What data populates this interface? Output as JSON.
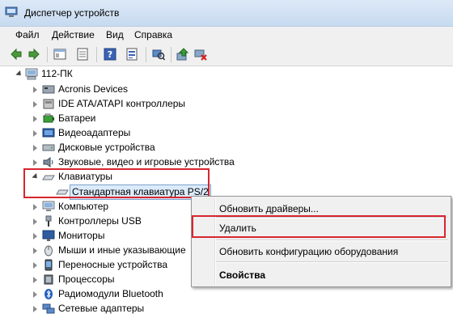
{
  "window": {
    "title": "Диспетчер устройств"
  },
  "menu": [
    "Файл",
    "Действие",
    "Вид",
    "Справка"
  ],
  "toolbar_icons": [
    "back-arrow-icon",
    "forward-arrow-icon",
    "tree-view-icon",
    "properties-sheet-icon",
    "help-icon",
    "device-list-icon",
    "scan-hardware-icon",
    "update-driver-icon",
    "uninstall-device-icon"
  ],
  "tree": {
    "root": "112-ПК",
    "items": [
      {
        "label": "Acronis Devices",
        "icon": "acronis-icon",
        "expanded": false
      },
      {
        "label": "IDE ATA/ATAPI контроллеры",
        "icon": "ide-controller-icon",
        "expanded": false
      },
      {
        "label": "Батареи",
        "icon": "battery-icon",
        "expanded": false
      },
      {
        "label": "Видеоадаптеры",
        "icon": "display-adapter-icon",
        "expanded": false
      },
      {
        "label": "Дисковые устройства",
        "icon": "disk-drive-icon",
        "expanded": false
      },
      {
        "label": "Звуковые, видео и игровые устройства",
        "icon": "sound-icon",
        "expanded": false
      },
      {
        "label": "Клавиатуры",
        "icon": "keyboard-icon",
        "expanded": true,
        "children": [
          {
            "label": "Стандартная клавиатура PS/2",
            "icon": "keyboard-icon"
          }
        ]
      },
      {
        "label": "Компьютер",
        "icon": "computer-icon",
        "expanded": false
      },
      {
        "label": "Контроллеры USB",
        "icon": "usb-icon",
        "expanded": false
      },
      {
        "label": "Мониторы",
        "icon": "monitor-icon",
        "expanded": false
      },
      {
        "label": "Мыши и иные указывающие",
        "icon": "mouse-icon",
        "expanded": false
      },
      {
        "label": "Переносные устройства",
        "icon": "portable-device-icon",
        "expanded": false
      },
      {
        "label": "Процессоры",
        "icon": "processor-icon",
        "expanded": false
      },
      {
        "label": "Радиомодули Bluetooth",
        "icon": "bluetooth-icon",
        "expanded": false
      },
      {
        "label": "Сетевые адаптеры",
        "icon": "network-adapter-icon",
        "expanded": false
      }
    ]
  },
  "context_menu": {
    "items": [
      {
        "label": "Обновить драйверы...",
        "bold": false
      },
      {
        "label": "Удалить",
        "bold": false
      },
      {
        "label": "Обновить конфигурацию оборудования",
        "bold": false
      },
      {
        "label": "Свойства",
        "bold": true
      }
    ]
  },
  "highlight_color": "#d7262f"
}
